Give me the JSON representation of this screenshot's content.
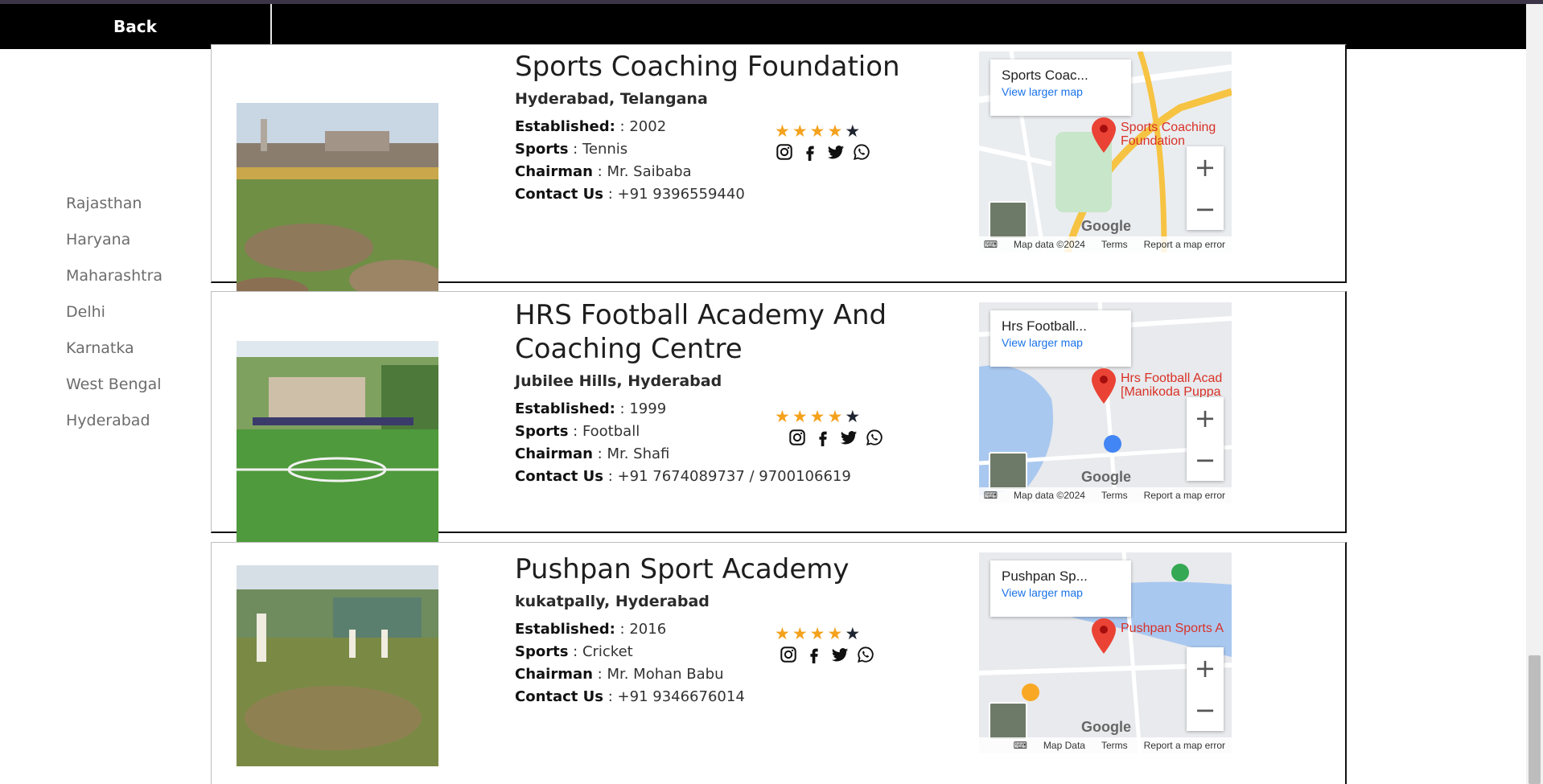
{
  "header": {
    "back_label": "Back"
  },
  "sidebar": {
    "items": [
      "Rajasthan",
      "Haryana",
      "Maharashtra",
      "Delhi",
      "Karnatka",
      "West Bengal",
      "Hyderabad"
    ]
  },
  "labels": {
    "established": "Established:",
    "sports": "Sports",
    "chairman": "Chairman",
    "contact": "Contact Us"
  },
  "cards": [
    {
      "name": "Sports Coaching Foundation",
      "location": "Hyderabad, Telangana",
      "established": ": 2002",
      "sport": ": Tennis",
      "chairman": ": Mr. Saibaba",
      "contact": ": +91 9396559440",
      "rating": 4,
      "map": {
        "title": "Sports Coac...",
        "link": "View larger map",
        "pin_label": "Sports Coaching\nFoundation",
        "attribution": "Map data ©2024",
        "terms": "Terms",
        "report": "Report a map error"
      }
    },
    {
      "name": "HRS Football Academy And Coaching Centre",
      "location": "Jubilee Hills, Hyderabad",
      "established": ": 1999",
      "sport": ": Football",
      "chairman": ": Mr. Shafi",
      "contact": ": +91 7674089737 / 9700106619",
      "rating": 4,
      "map": {
        "title": "Hrs Football...",
        "link": "View larger map",
        "pin_label": "Hrs Football Acad\n[Manikoda Puppa",
        "attribution": "Map data ©2024",
        "terms": "Terms",
        "report": "Report a map error"
      }
    },
    {
      "name": "Pushpan Sport Academy",
      "location": "kukatpally, Hyderabad",
      "established": ": 2016",
      "sport": ": Cricket",
      "chairman": ": Mr. Mohan Babu",
      "contact": ": +91 9346676014",
      "rating": 4,
      "map": {
        "title": "Pushpan Sp...",
        "link": "View larger map",
        "pin_label": "Pushpan Sports A",
        "attribution": "Map Data",
        "terms": "Terms",
        "report": "Report a map error"
      }
    }
  ],
  "map_google": "Google",
  "map_zoom_in": "+",
  "map_zoom_out": "−",
  "icons": [
    "instagram-icon",
    "facebook-icon",
    "twitter-icon",
    "whatsapp-icon",
    "star-icon",
    "map-pin-icon"
  ],
  "colors": {
    "header_bg": "#000000",
    "star": "#f4a11c",
    "map_link": "#1a73e8",
    "pin": "#ea4335"
  }
}
